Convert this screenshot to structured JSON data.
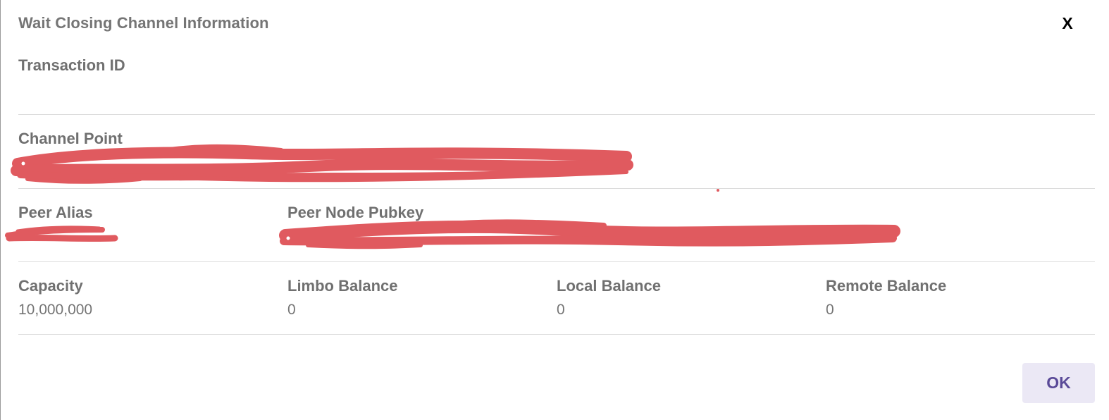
{
  "dialog": {
    "title": "Wait Closing Channel Information",
    "close_label": "X",
    "ok_label": "OK"
  },
  "transaction": {
    "label": "Transaction ID",
    "value": ""
  },
  "channel_point": {
    "label": "Channel Point",
    "redacted": true
  },
  "peer": {
    "alias_label": "Peer Alias",
    "alias_redacted": true,
    "pubkey_label": "Peer Node Pubkey",
    "pubkey_redacted": true
  },
  "balances": [
    {
      "label": "Capacity",
      "value": "10,000,000"
    },
    {
      "label": "Limbo Balance",
      "value": "0"
    },
    {
      "label": "Local Balance",
      "value": "0"
    },
    {
      "label": "Remote Balance",
      "value": "0"
    }
  ],
  "colors": {
    "label_text": "#707070",
    "value_text": "#757575",
    "redaction": "#e05a5f",
    "ok_button_bg": "#ebe8f5",
    "ok_button_text": "#5a4a98",
    "divider": "#dcdcdc"
  }
}
